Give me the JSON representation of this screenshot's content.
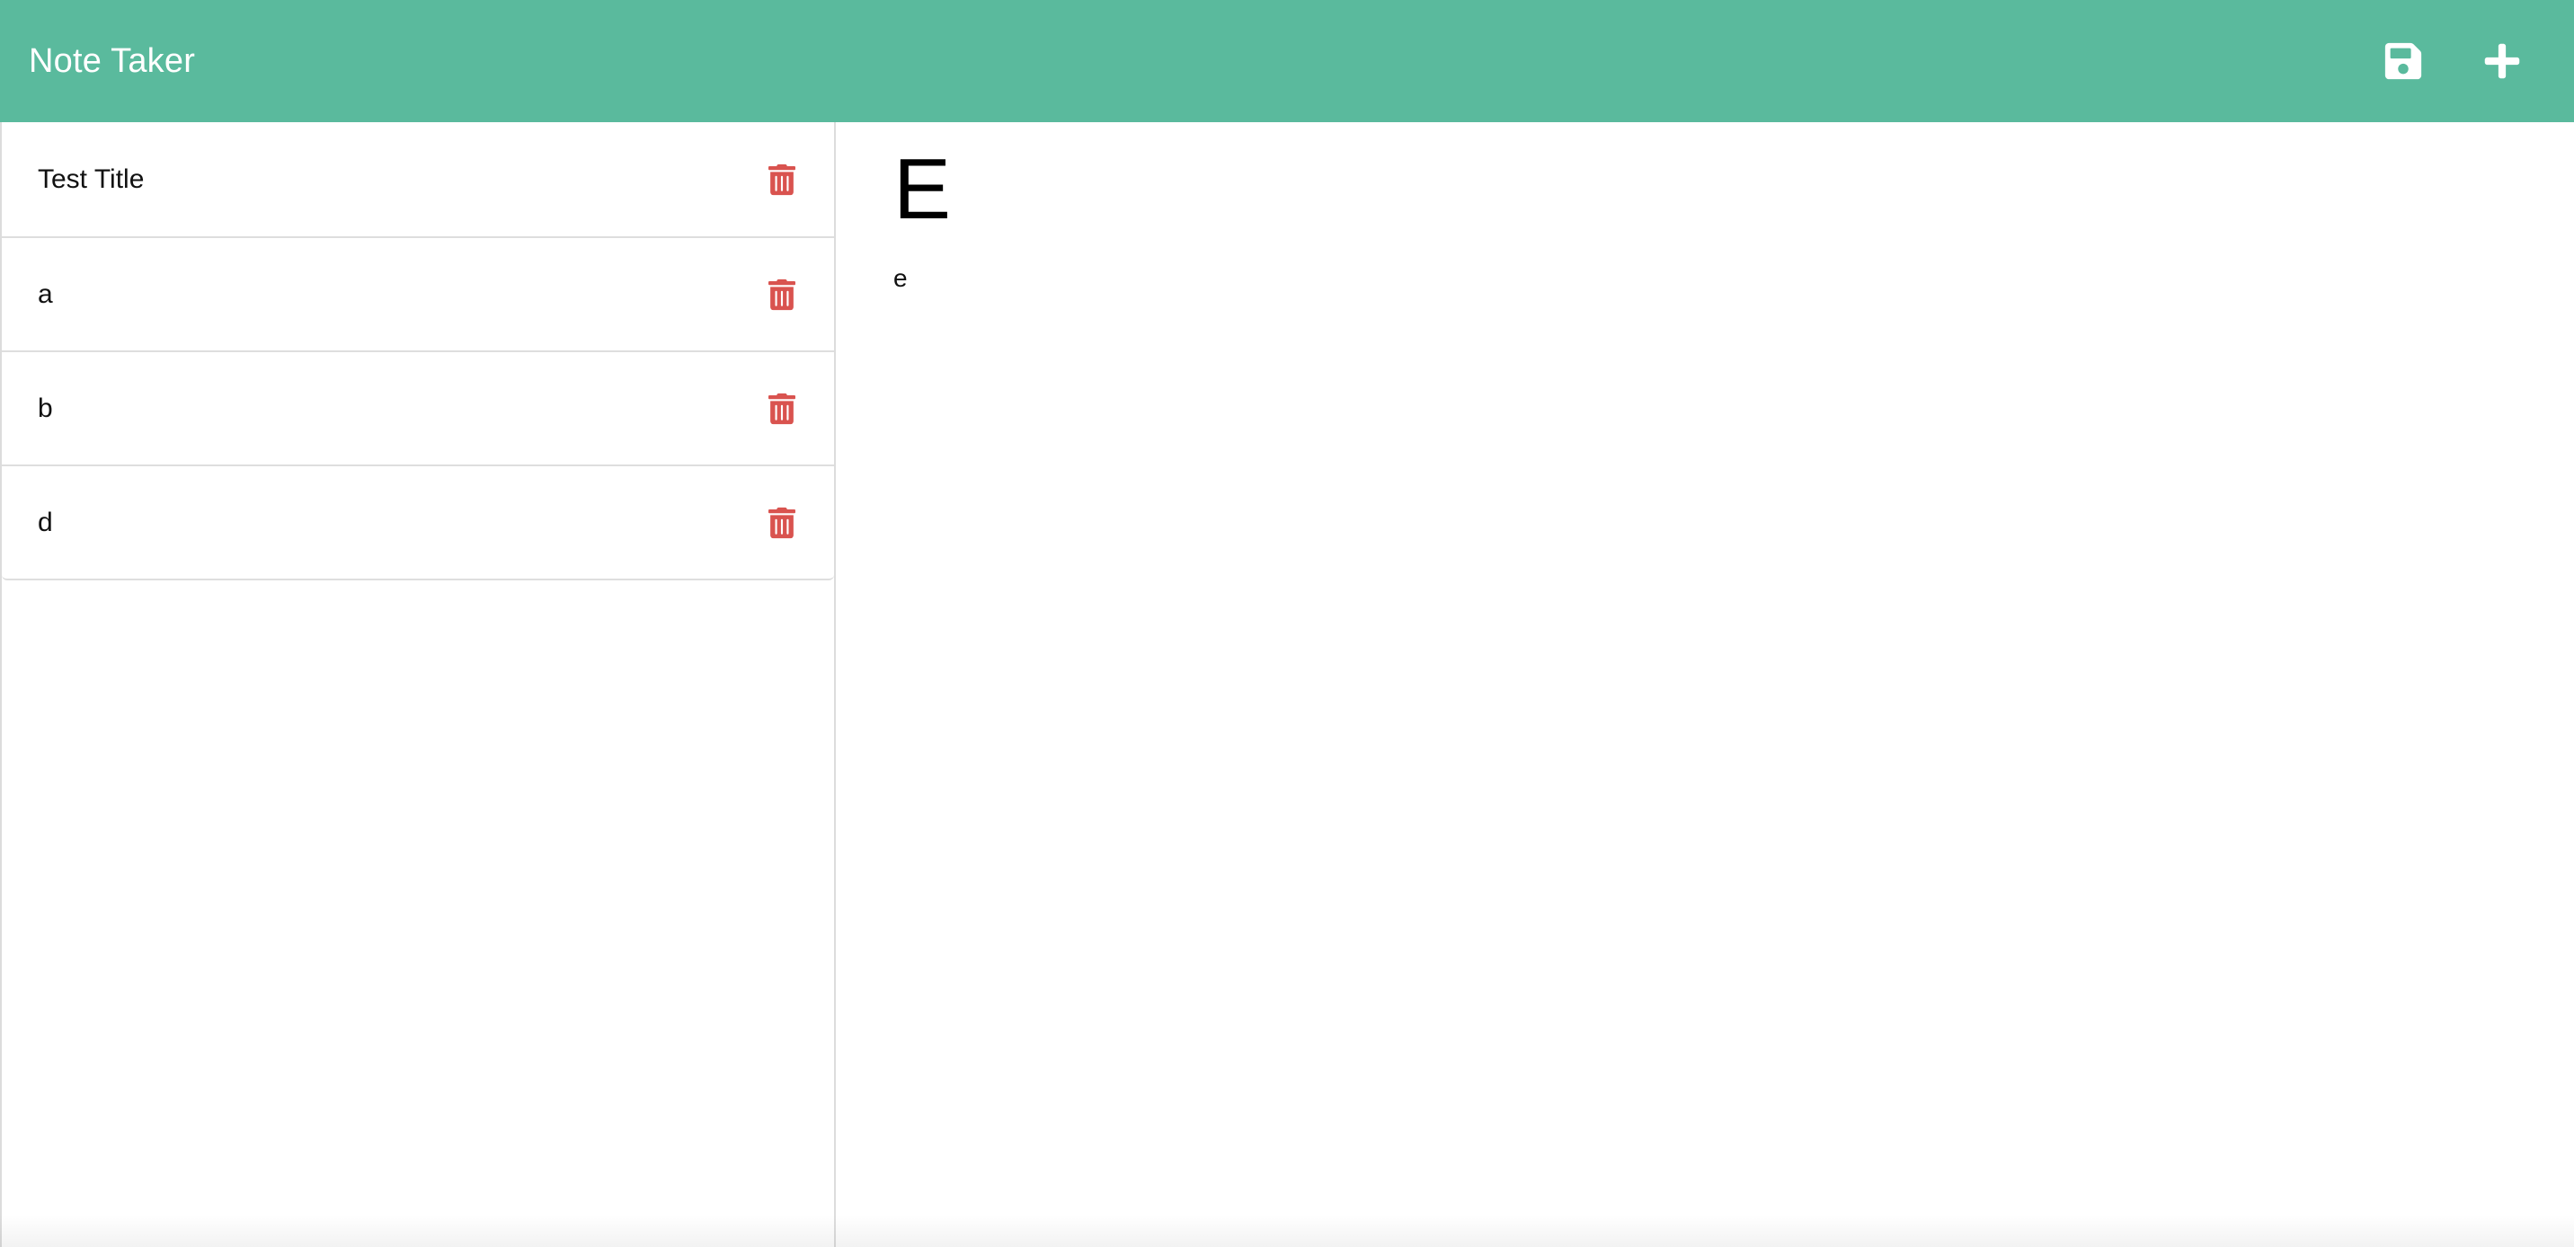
{
  "app": {
    "brand": "Note Taker",
    "colors": {
      "nav_bg": "#5ABA9D",
      "nav_icon": "#ffffff",
      "trash": "#d9534f"
    },
    "icons": {
      "save": "save-icon",
      "new_note": "plus-icon",
      "delete": "trash-icon"
    }
  },
  "notes": [
    {
      "title": "Test Title"
    },
    {
      "title": "a"
    },
    {
      "title": "b"
    },
    {
      "title": "d"
    }
  ],
  "active_note": {
    "title": "E",
    "text": "e"
  }
}
